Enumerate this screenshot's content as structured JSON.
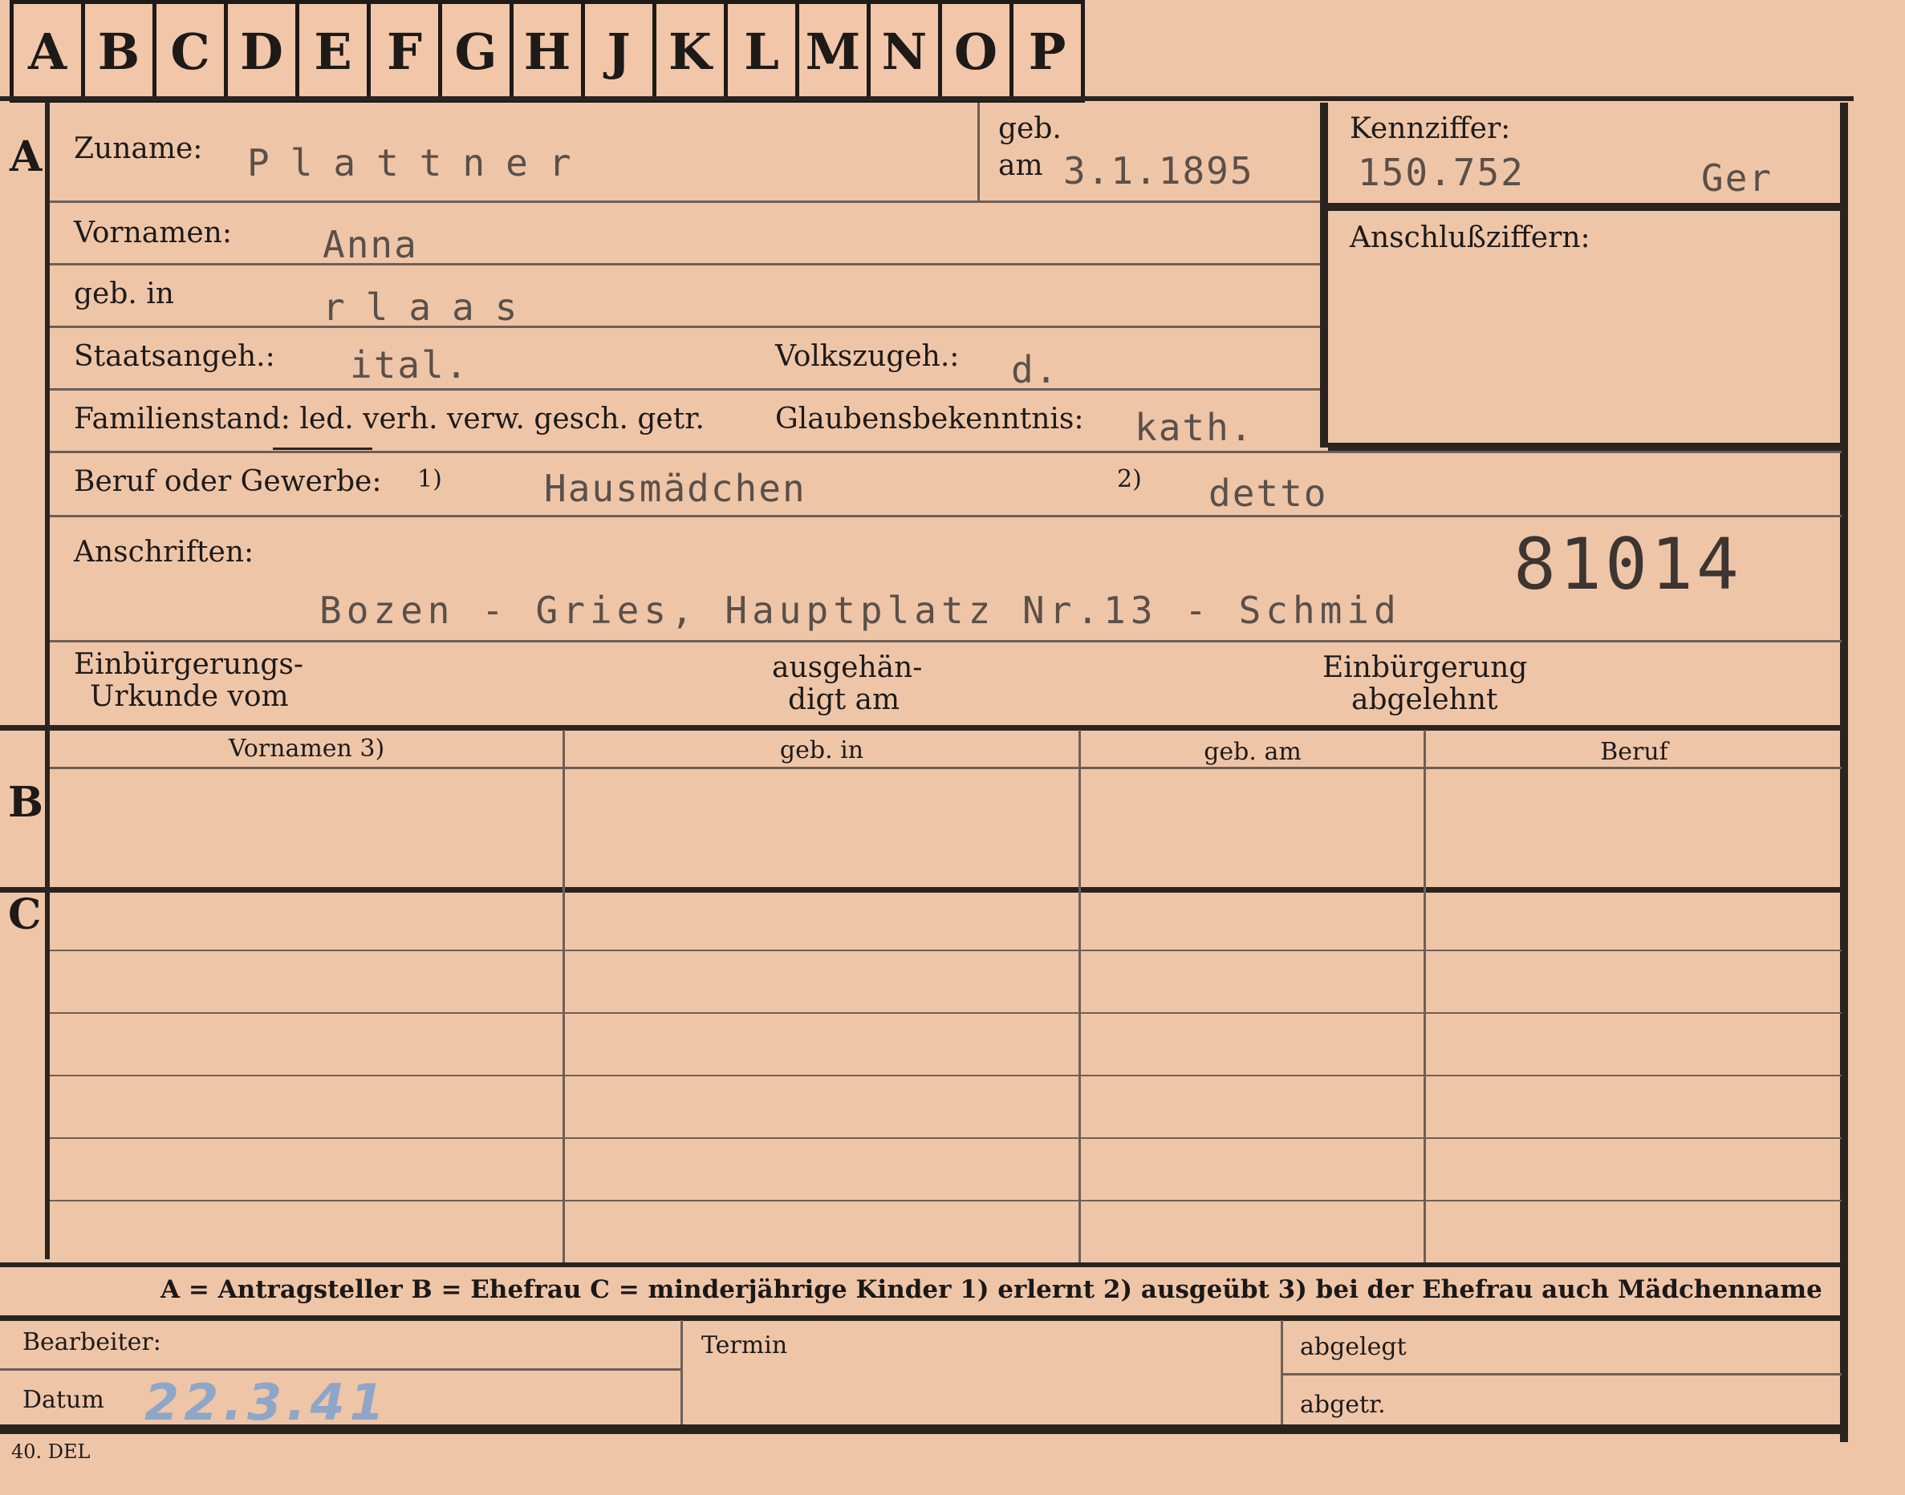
{
  "tabs": [
    "A",
    "B",
    "C",
    "D",
    "E",
    "F",
    "G",
    "H",
    "J",
    "K",
    "L",
    "M",
    "N",
    "O",
    "P"
  ],
  "rows": {
    "a": "A",
    "b": "B",
    "c": "C"
  },
  "fields": {
    "zuname_label": "Zuname:",
    "zuname_value": "Plattner",
    "geb_label": "geb.",
    "am_label": "am",
    "geb_am_value": "3.1.1895",
    "kennziffer_label": "Kennziffer:",
    "kennziffer_value": "150.752",
    "kennziffer_suffix": "Ger",
    "anschluss_label": "Anschlußziffern:",
    "vornamen_label": "Vornamen:",
    "vornamen_value": "Anna",
    "geb_in_label": "geb. in",
    "geb_in_value": "rlaas",
    "staatsangeh_label": "Staatsangeh.:",
    "staatsangeh_value": "ital.",
    "volkszugeh_label": "Volkszugeh.:",
    "volkszugeh_value": "d.",
    "familienstand_label": "Familienstand: led. verh. verw. gesch. getr.",
    "glauben_label": "Glaubensbekenntnis:",
    "glauben_value": "kath.",
    "beruf_label": "Beruf oder Gewerbe:",
    "beruf_mark1": "1)",
    "beruf_value1": "Hausmädchen",
    "beruf_mark2": "2)",
    "beruf_value2": "detto",
    "anschriften_label": "Anschriften:",
    "anschriften_number": "81014",
    "anschriften_value": "Bozen - Gries, Hauptplatz Nr.13 - Schmid",
    "einb_urkunde_label1": "Einbürgerungs-",
    "einb_urkunde_label2": "Urkunde vom",
    "ausgehaend_label1": "ausgehän-",
    "ausgehaend_label2": "digt am",
    "einb_abgelehnt_label1": "Einbürgerung",
    "einb_abgelehnt_label2": "abgelehnt"
  },
  "table_headers": [
    "Vornamen 3)",
    "geb. in",
    "geb. am",
    "Beruf"
  ],
  "legend": "A = Antragsteller   B = Ehefrau   C = minderjährige Kinder   1) erlernt   2) ausgeübt   3) bei der Ehefrau auch Mädchenname",
  "footer": {
    "bearbeiter_label": "Bearbeiter:",
    "termin_label": "Termin",
    "abgelegt_label": "abgelegt",
    "datum_label": "Datum",
    "datum_value": "22.3.41",
    "abgetr_label": "abgetr.",
    "form_code": "40. DEL"
  }
}
